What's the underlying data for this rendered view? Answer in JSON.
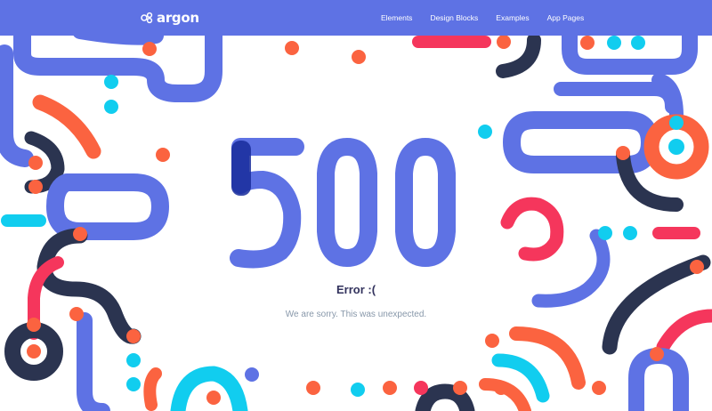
{
  "theme": {
    "primary": "#5e72e4",
    "dark": "#2b3450",
    "orange": "#fb6340",
    "cyan": "#11cdef",
    "pink": "#f5365c"
  },
  "navbar": {
    "brand": "argon",
    "brand_icon": "argon-logo-icon",
    "links": [
      "Elements",
      "Design Blocks",
      "Examples",
      "App Pages"
    ]
  },
  "error": {
    "code": "500",
    "title": "Error :(",
    "message": "We are sorry. This was unexpected."
  }
}
